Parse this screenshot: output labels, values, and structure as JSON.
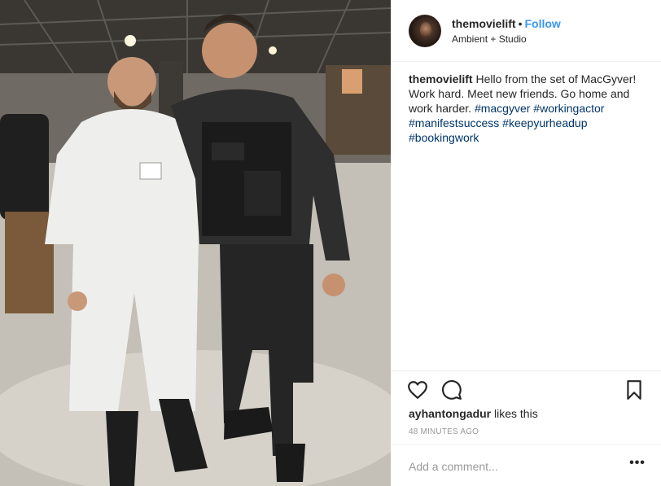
{
  "post": {
    "header": {
      "username": "themovielift",
      "separator": "•",
      "follow_label": "Follow",
      "location": "Ambient + Studio"
    },
    "caption": {
      "username": "themovielift",
      "text_before_tags": "Hello from the set of MacGyver! Work hard. Meet new friends. Go home and work harder.",
      "hashtags": [
        "#macgyver",
        "#workingactor",
        "#manifestsuccess",
        "#keepyurheadup",
        "#bookingwork"
      ]
    },
    "actions": {
      "like_icon": "heart-icon",
      "comment_icon": "comment-icon",
      "save_icon": "bookmark-icon"
    },
    "likes": {
      "liker": "ayhantongadur",
      "suffix": "likes this"
    },
    "timestamp": "48 MINUTES AGO",
    "comment_box": {
      "placeholder": "Add a comment...",
      "more_label": "•••"
    },
    "colors": {
      "link_blue": "#3897f0",
      "hashtag_blue": "#003569",
      "muted_gray": "#999999",
      "divider": "#efefef"
    }
  }
}
